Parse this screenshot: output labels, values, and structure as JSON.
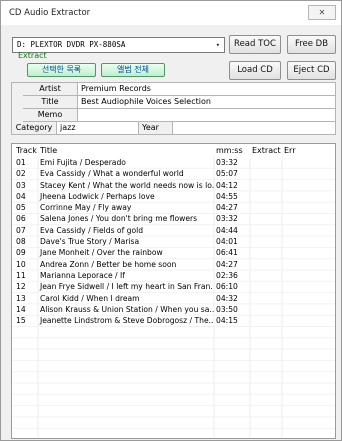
{
  "window": {
    "title": "CD Audio Extractor",
    "close_glyph": "✕"
  },
  "drive": {
    "selected": "D: PLEXTOR DVDR   PX-880SA",
    "arrow": "▾"
  },
  "buttons": {
    "read_toc": "Read TOC",
    "free_db": "Free DB",
    "load_cd": "Load CD",
    "eject_cd": "Eject CD"
  },
  "extract": {
    "label": "Extract",
    "selected_tracks": "선택한 목록",
    "whole_album": "앨범 전체"
  },
  "album": {
    "artist_label": "Artist",
    "artist": "Premium Records",
    "title_label": "Title",
    "title": "Best Audiophile Voices Selection",
    "memo_label": "Memo",
    "memo": "",
    "category_label": "Category",
    "category": "jazz",
    "year_label": "Year",
    "year": ""
  },
  "tracklist": {
    "columns": [
      "Track",
      "Title",
      "mm:ss",
      "Extract",
      "Err"
    ],
    "rows": [
      [
        "01",
        "Emi Fujita / Desperado",
        "03:32",
        "",
        ""
      ],
      [
        "02",
        "Eva Cassidy / What a wonderful world",
        "05:07",
        "",
        ""
      ],
      [
        "03",
        "Stacey Kent / What the world needs now is lo...",
        "04:12",
        "",
        ""
      ],
      [
        "04",
        "Jheena Lodwick / Perhaps love",
        "04:55",
        "",
        ""
      ],
      [
        "05",
        "Corrinne May / Fly away",
        "04:27",
        "",
        ""
      ],
      [
        "06",
        "Salena Jones / You don't bring me flowers",
        "03:32",
        "",
        ""
      ],
      [
        "07",
        "Eva Cassidy / Fields of gold",
        "04:44",
        "",
        ""
      ],
      [
        "08",
        "Dave's True Story / Marisa",
        "04:01",
        "",
        ""
      ],
      [
        "09",
        "Jane Monheit / Over the rainbow",
        "06:41",
        "",
        ""
      ],
      [
        "10",
        "Andrea Zonn / Better be home soon",
        "04:27",
        "",
        ""
      ],
      [
        "11",
        "Marianna Leporace / If",
        "02:36",
        "",
        ""
      ],
      [
        "12",
        "Jean Frye Sidwell / I left my heart in San Fran...",
        "06:10",
        "",
        ""
      ],
      [
        "13",
        "Carol Kidd / When I dream",
        "04:32",
        "",
        ""
      ],
      [
        "14",
        "Alison Krauss & Union Station / When you sa...",
        "03:50",
        "",
        ""
      ],
      [
        "15",
        "Jeanette Lindstrom & Steve Dobrogosz / The...",
        "04:15",
        "",
        ""
      ]
    ]
  },
  "colors": {
    "extract_label": "#0a7f0a",
    "korean_button_text": "#004ca0",
    "korean_button_bg": "#bfeecd"
  }
}
